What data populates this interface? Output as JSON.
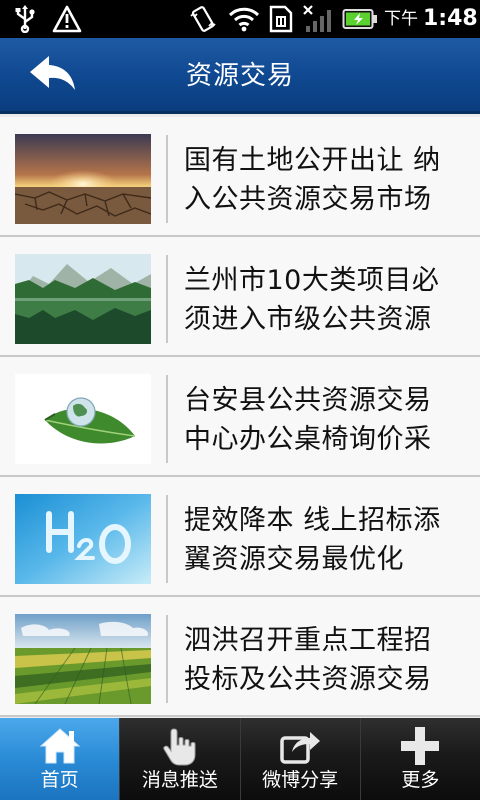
{
  "status_bar": {
    "ampm": "下午",
    "time": "1:48",
    "icons": [
      "usb-icon",
      "alert-icon",
      "vibrate-icon",
      "wifi-icon",
      "sim-icon",
      "signal-icon",
      "battery-icon"
    ]
  },
  "header": {
    "title": "资源交易",
    "back_icon": "back-arrow-icon",
    "bar_color": "#0f4890"
  },
  "list": {
    "items": [
      {
        "title": "国有土地公开出让 纳\n入公共资源交易市场",
        "thumb": "cracked-earth-sunset"
      },
      {
        "title": "兰州市10大类项目必\n须进入市级公共资源",
        "thumb": "mountain-lake-reflection"
      },
      {
        "title": "台安县公共资源交易\n中心办公桌椅询价采",
        "thumb": "globe-on-leaf"
      },
      {
        "title": "提效降本 线上招标添\n翼资源交易最优化",
        "thumb": "h2o-water-text"
      },
      {
        "title": "泗洪召开重点工程招\n投标及公共资源交易",
        "thumb": "green-farm-fields"
      }
    ]
  },
  "bottom_nav": {
    "active_color": "#2a8bd6",
    "items": [
      {
        "label": "首页",
        "icon": "home-icon",
        "active": true
      },
      {
        "label": "消息推送",
        "icon": "tap-hand-icon",
        "active": false
      },
      {
        "label": "微博分享",
        "icon": "share-icon",
        "active": false
      },
      {
        "label": "更多",
        "icon": "plus-icon",
        "active": false
      }
    ]
  }
}
